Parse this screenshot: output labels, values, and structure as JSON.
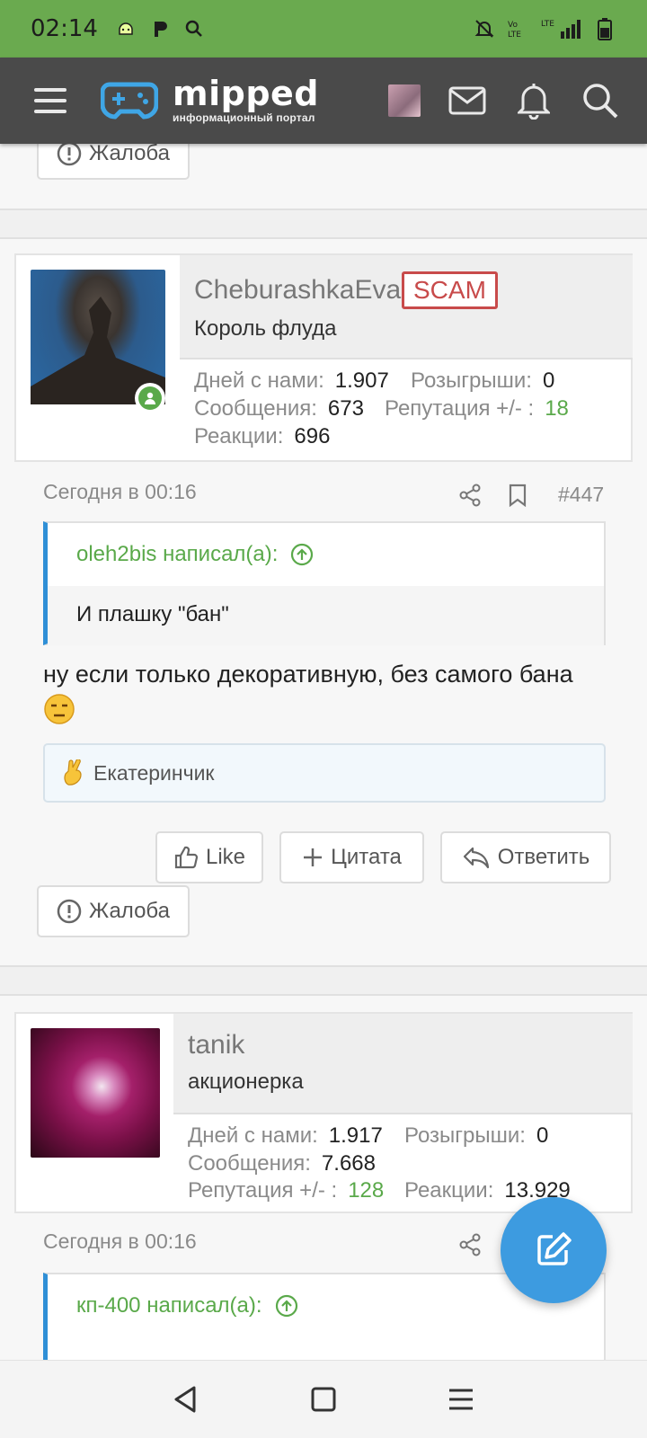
{
  "status_bar": {
    "time": "02:14",
    "network": "LTE"
  },
  "app_bar": {
    "logo_name": "mipped",
    "logo_subtitle": "информационный портал"
  },
  "buttons": {
    "report": "Жалоба",
    "like": "Like",
    "quote": "Цитата",
    "reply": "Ответить"
  },
  "posts": [
    {
      "username": "CheburashkaEva",
      "badge": "SCAM",
      "user_title": "Король флуда",
      "stats": {
        "days_label": "Дней с нами:",
        "days": "1.907",
        "draws_label": "Розыгрыши:",
        "draws": "0",
        "messages_label": "Сообщения:",
        "messages": "673",
        "rep_label": "Репутация +/- :",
        "rep": "18",
        "reactions_label": "Реакции:",
        "reactions": "696"
      },
      "date": "Сегодня в 00:16",
      "number": "#447",
      "quote_author": "oleh2bis написал(а):",
      "quote_text": "И плашку \"бан\"",
      "text": "ну если только декоративную, без самого бана",
      "reaction_user": "Екатеринчик"
    },
    {
      "username": "tanik",
      "user_title": "акционерка",
      "stats": {
        "days_label": "Дней с нами:",
        "days": "1.917",
        "draws_label": "Розыгрыши:",
        "draws": "0",
        "messages_label": "Сообщения:",
        "messages": "7.668",
        "rep_label": "Репутация +/- :",
        "rep": "128",
        "reactions_label": "Реакции:",
        "reactions": "13.929"
      },
      "date": "Сегодня в 00:16",
      "quote_author": "кп-400 написал(а):"
    }
  ],
  "colors": {
    "status_bar": "#6aaa4f",
    "app_bar": "#4a4a4a",
    "accent_green": "#5aa94a",
    "accent_blue": "#3d9be0",
    "scam_red": "#c84b4b"
  }
}
